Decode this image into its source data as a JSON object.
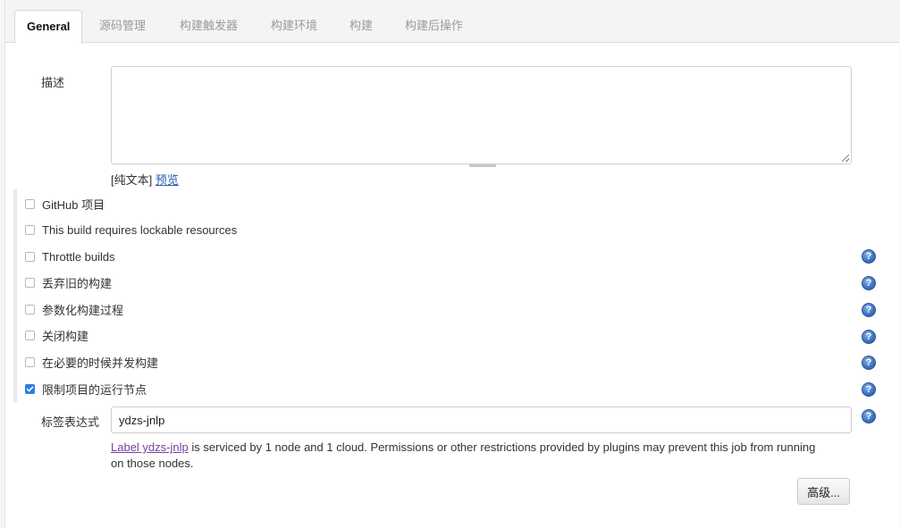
{
  "tabs": [
    {
      "label": "General",
      "active": true
    },
    {
      "label": "源码管理",
      "active": false
    },
    {
      "label": "构建触发器",
      "active": false
    },
    {
      "label": "构建环境",
      "active": false
    },
    {
      "label": "构建",
      "active": false
    },
    {
      "label": "构建后操作",
      "active": false
    }
  ],
  "description": {
    "label": "描述",
    "value": "",
    "plain_text_label": "[纯文本]",
    "preview_link": "预览"
  },
  "options": [
    {
      "label": "GitHub 项目",
      "checked": false,
      "help": false
    },
    {
      "label": "This build requires lockable resources",
      "checked": false,
      "help": false
    },
    {
      "label": "Throttle builds",
      "checked": false,
      "help": true
    },
    {
      "label": "丢弃旧的构建",
      "checked": false,
      "help": true
    },
    {
      "label": "参数化构建过程",
      "checked": false,
      "help": true
    },
    {
      "label": "关闭构建",
      "checked": false,
      "help": true
    },
    {
      "label": "在必要的时候并发构建",
      "checked": false,
      "help": true
    },
    {
      "label": "限制项目的运行节点",
      "checked": true,
      "help": true
    }
  ],
  "label_expression": {
    "label": "标签表达式",
    "value": "ydzs-jnlp",
    "link_text": "Label ydzs-jnlp",
    "message": " is serviced by 1 node and 1 cloud. Permissions or other restrictions provided by plugins may prevent this job from running on those nodes."
  },
  "advanced_button": "高级...",
  "help_glyph": "?",
  "colors": {
    "accent": "#2f7de1",
    "link": "#2a5db0",
    "visited_link": "#7b3f9e",
    "help_icon": "#3f74c2"
  }
}
